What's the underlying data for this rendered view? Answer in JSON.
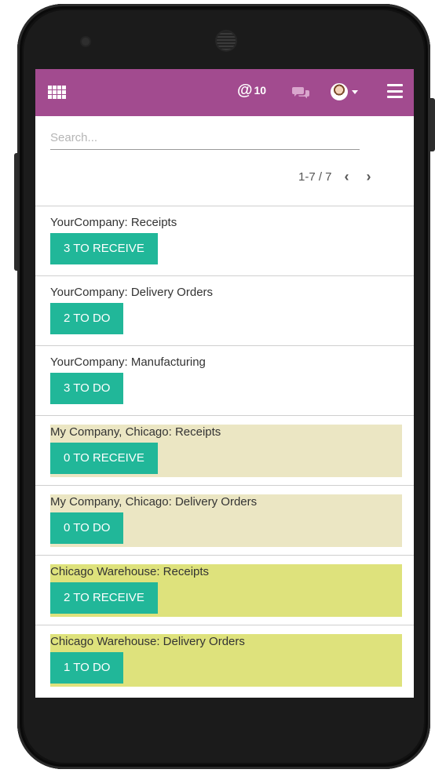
{
  "colors": {
    "topbar": "#a24b8f",
    "button": "#21b799",
    "card_highlight_light": "#ebe6c3",
    "card_highlight_strong": "#dee27c"
  },
  "topbar": {
    "apps_icon": "grid-icon",
    "mentions_symbol": "@",
    "mentions_count": "10",
    "chat_icon": "chat-bubbles-icon",
    "avatar": "user-avatar",
    "menu_icon": "hamburger-menu-icon"
  },
  "search": {
    "placeholder": "Search..."
  },
  "pager": {
    "text": "1-7 / 7",
    "prev": "‹",
    "next": "›"
  },
  "cards": [
    {
      "title": "YourCompany: Receipts",
      "button": "3 TO RECEIVE",
      "bg": ""
    },
    {
      "title": "YourCompany: Delivery Orders",
      "button": "2 TO DO",
      "bg": ""
    },
    {
      "title": "YourCompany: Manufacturing",
      "button": "3 TO DO",
      "bg": ""
    },
    {
      "title": "My Company, Chicago: Receipts",
      "button": "0 TO RECEIVE",
      "bg": "#ebe6c3"
    },
    {
      "title": "My Company, Chicago: Delivery Orders",
      "button": "0 TO DO",
      "bg": "#ebe6c3"
    },
    {
      "title": "Chicago Warehouse: Receipts",
      "button": "2 TO RECEIVE",
      "bg": "#dee27c"
    },
    {
      "title": "Chicago Warehouse: Delivery Orders",
      "button": "1 TO DO",
      "bg": "#dee27c"
    }
  ]
}
